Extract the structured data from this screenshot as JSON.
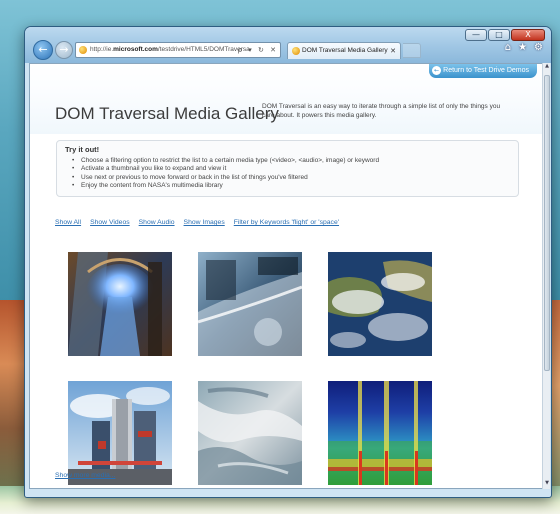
{
  "browser": {
    "address_prefix": "http://ie.",
    "address_domain": "microsoft.com",
    "address_path": "/testdrive/HTML5/DOMTraversa",
    "address_icons": "ρ ▾ ↻ ✕",
    "tab_title": "DOM Traversal Media Gallery",
    "window_controls": {
      "minimize": "—",
      "maximize": "□",
      "close": "X"
    },
    "tools": {
      "home": "⌂",
      "favorites": "★",
      "settings": "⚙"
    }
  },
  "page": {
    "return_label": "Return to Test Drive Demos",
    "title": "DOM Traversal Media Gallery",
    "intro": "DOM Traversal is an easy way to iterate through a simple list of only the things you care about. It powers this media gallery.",
    "tryit": {
      "heading": "Try it out!",
      "items": [
        "Choose a filtering option to restrict the list to a certain media type (<video>, <audio>, image) or keyword",
        "Activate a thumbnail you like to expand and view it",
        "Use next or previous to move forward or back in the list of things you've filtered",
        "Enjoy the content from NASA's multimedia library"
      ]
    },
    "filters": [
      "Show All",
      "Show Videos",
      "Show Audio",
      "Show Images",
      "Filter by Keywords 'flight' or 'space'"
    ],
    "show_more": "Show more media..."
  },
  "gallery": [
    {
      "subject": "rocket-engine-test"
    },
    {
      "subject": "shuttle-window-view"
    },
    {
      "subject": "earth-from-orbit"
    },
    {
      "subject": "launch-pad-tower"
    },
    {
      "subject": "mountain-terrain"
    },
    {
      "subject": "audio-spectrogram"
    }
  ],
  "colors": {
    "link": "#2a6fb3",
    "accent_button": "#3b92cc",
    "title_text": "#3c3c3c"
  }
}
